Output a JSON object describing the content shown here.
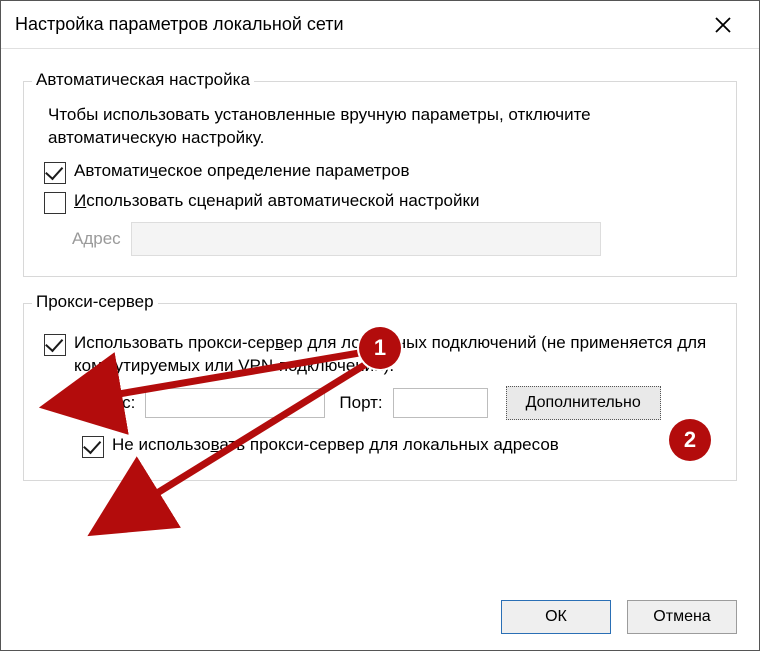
{
  "window": {
    "title": "Настройка параметров локальной сети"
  },
  "auto": {
    "legend": "Автоматическая настройка",
    "description": "Чтобы использовать установленные вручную параметры, отключите автоматическую настройку.",
    "detect_prefix": "Автомати",
    "detect_u": "ч",
    "detect_suffix": "еское определение параметров",
    "script_u": "И",
    "script_suffix": "спользовать сценарий автоматической настройки",
    "address_label": "Адрес"
  },
  "proxy": {
    "legend": "Прокси-сервер",
    "use_prefix": "Использовать прокси-сер",
    "use_u": "в",
    "use_suffix": "ер для локальных подключений (не применяется для коммутируемых или VPN-подключений).",
    "address_label": "Адрес:",
    "port_label": "Порт:",
    "advanced_label": "Дополнительно",
    "bypass_prefix": "Не использо",
    "bypass_u": "в",
    "bypass_suffix": "ать прокси-сервер для локальных адресов"
  },
  "buttons": {
    "ok": "ОК",
    "cancel": "Отмена"
  },
  "annotations": {
    "badge1": "1",
    "badge2": "2",
    "color": "#b30c0c"
  }
}
